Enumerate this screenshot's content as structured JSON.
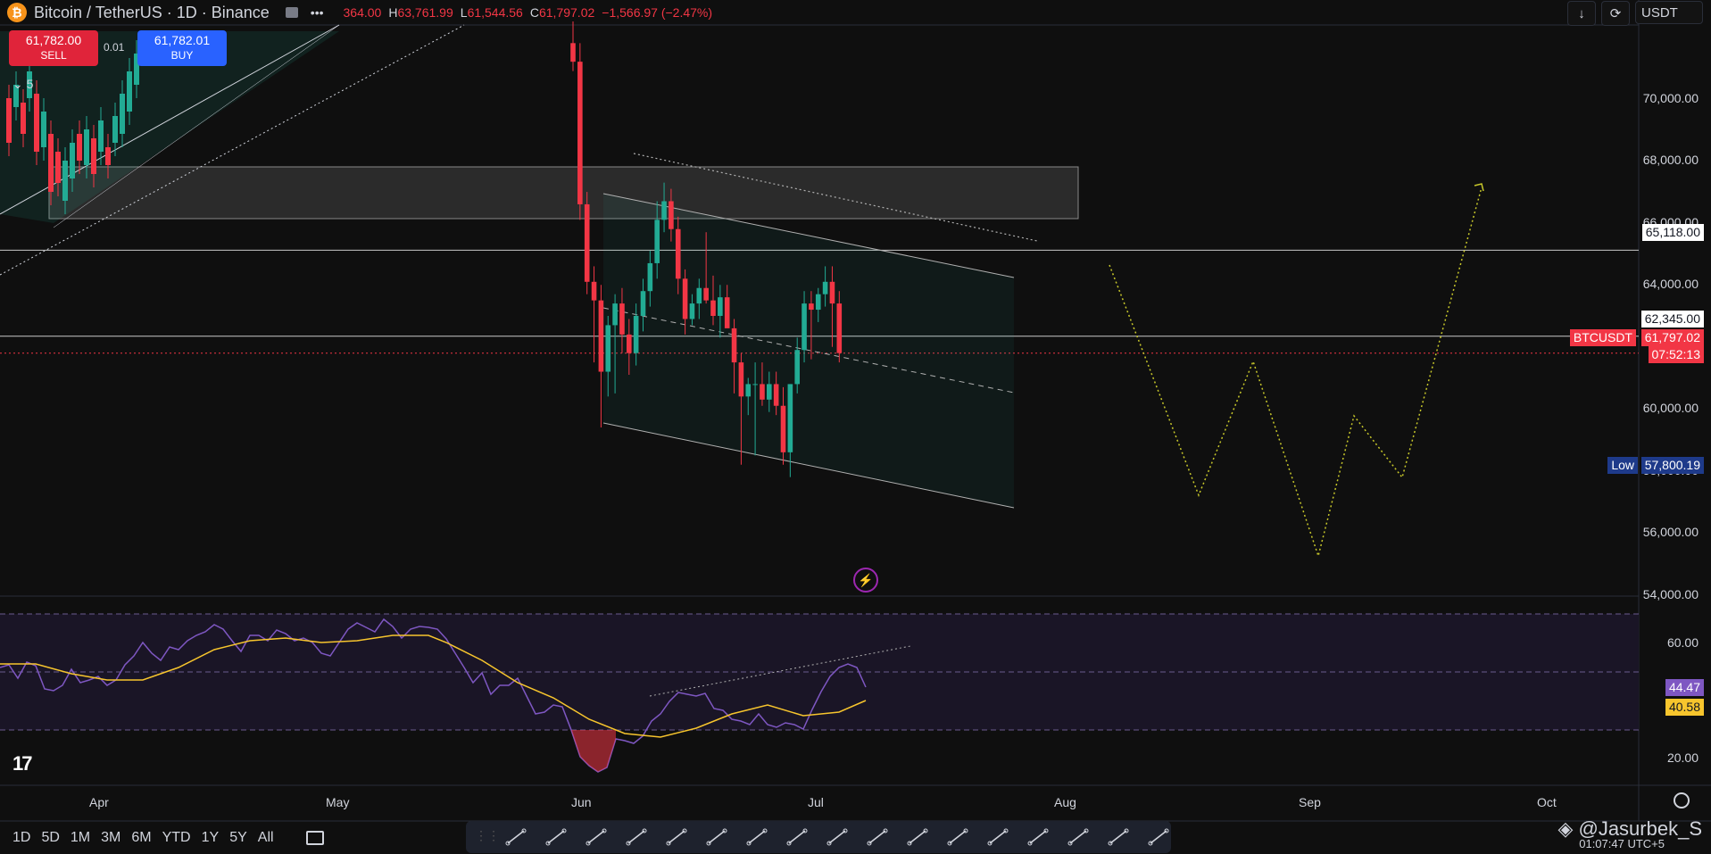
{
  "header": {
    "coin_icon": "bitcoin-icon",
    "symbol": "Bitcoin / TetherUS · 1D · Binance",
    "ohlc_open": "364.00",
    "ohlc_high_label": "H",
    "ohlc_high": "63,761.99",
    "ohlc_low_label": "L",
    "ohlc_low": "61,544.56",
    "ohlc_close_label": "C",
    "ohlc_close": "61,797.02",
    "ohlc_change": "−1,566.97 (−2.47%)",
    "currency": "USDT"
  },
  "trade": {
    "sell_price": "61,782.00",
    "sell_label": "SELL",
    "spread": "0.01",
    "buy_price": "61,782.01",
    "buy_label": "BUY",
    "collapse_count": "5"
  },
  "price_axis": {
    "ticks": [
      "70,000.00",
      "68,000.00",
      "66,000.00",
      "64,000.00",
      "60,000.00",
      "58,000.00",
      "56,000.00",
      "54,000.00"
    ],
    "tick_values": [
      70000,
      68000,
      66000,
      64000,
      60000,
      58000,
      56000,
      54000
    ],
    "line_65118": "65,118.00",
    "line_62345": "62,345.00",
    "ticker_tag": "BTCUSDT",
    "current_price": "61,797.02",
    "countdown": "07:52:13",
    "low_label": "Low",
    "low_value": "57,800.19"
  },
  "rsi_axis": {
    "ticks": [
      "60.00",
      "20.00"
    ],
    "rsi_value": "44.47",
    "ma_value": "40.58"
  },
  "time_axis": [
    "Apr",
    "May",
    "Jun",
    "Jul",
    "Aug",
    "Sep",
    "Oct"
  ],
  "ranges": [
    "1D",
    "5D",
    "1M",
    "3M",
    "6M",
    "YTD",
    "1Y",
    "5Y",
    "All"
  ],
  "footer": {
    "watermark": "@Jasurbek_S",
    "time": "01:07:47 UTC+5"
  },
  "colors": {
    "up": "#22ab94",
    "down": "#f23645",
    "rsi": "#7e57c2",
    "rsi_ma": "#f7c52d",
    "projection": "#c8c82a"
  },
  "chart_data": {
    "type": "candlestick",
    "ylim": [
      53500,
      72500
    ],
    "candles_may_jul": [
      {
        "o": 71800,
        "h": 72500,
        "l": 70900,
        "c": 71200
      },
      {
        "o": 71200,
        "h": 71800,
        "l": 66100,
        "c": 66600
      },
      {
        "o": 66600,
        "h": 67000,
        "l": 63700,
        "c": 64100
      },
      {
        "o": 64100,
        "h": 64600,
        "l": 61500,
        "c": 63500
      },
      {
        "o": 63500,
        "h": 64000,
        "l": 59400,
        "c": 61200
      },
      {
        "o": 61200,
        "h": 63000,
        "l": 60400,
        "c": 62700
      },
      {
        "o": 62700,
        "h": 63700,
        "l": 60500,
        "c": 63400
      },
      {
        "o": 63400,
        "h": 63900,
        "l": 61800,
        "c": 62400
      },
      {
        "o": 62400,
        "h": 62900,
        "l": 61100,
        "c": 61800
      },
      {
        "o": 61800,
        "h": 63400,
        "l": 61400,
        "c": 63000
      },
      {
        "o": 63000,
        "h": 64200,
        "l": 62500,
        "c": 63800
      },
      {
        "o": 63800,
        "h": 65100,
        "l": 63300,
        "c": 64700
      },
      {
        "o": 64700,
        "h": 66700,
        "l": 64200,
        "c": 66100
      },
      {
        "o": 66100,
        "h": 67300,
        "l": 65700,
        "c": 66700
      },
      {
        "o": 66700,
        "h": 67100,
        "l": 65400,
        "c": 65800
      },
      {
        "o": 65800,
        "h": 66200,
        "l": 63700,
        "c": 64200
      },
      {
        "o": 64200,
        "h": 64500,
        "l": 62400,
        "c": 62900
      },
      {
        "o": 62900,
        "h": 63700,
        "l": 62700,
        "c": 63400
      },
      {
        "o": 63400,
        "h": 64200,
        "l": 62900,
        "c": 63900
      },
      {
        "o": 63900,
        "h": 65700,
        "l": 63400,
        "c": 63500
      },
      {
        "o": 63500,
        "h": 64300,
        "l": 62700,
        "c": 63000
      },
      {
        "o": 63000,
        "h": 64000,
        "l": 62300,
        "c": 63600
      },
      {
        "o": 63600,
        "h": 64000,
        "l": 62900,
        "c": 62600
      },
      {
        "o": 62600,
        "h": 62900,
        "l": 60500,
        "c": 61500
      },
      {
        "o": 61500,
        "h": 61800,
        "l": 58200,
        "c": 60400
      },
      {
        "o": 60400,
        "h": 61000,
        "l": 59800,
        "c": 60800
      },
      {
        "o": 60800,
        "h": 61500,
        "l": 58500,
        "c": 60800
      },
      {
        "o": 60800,
        "h": 61500,
        "l": 60100,
        "c": 60300
      },
      {
        "o": 60300,
        "h": 61200,
        "l": 59900,
        "c": 60800
      },
      {
        "o": 60800,
        "h": 61200,
        "l": 59800,
        "c": 60100
      },
      {
        "o": 60100,
        "h": 60700,
        "l": 58200,
        "c": 58600
      },
      {
        "o": 58600,
        "h": 60800,
        "l": 57800,
        "c": 60800
      },
      {
        "o": 60800,
        "h": 62300,
        "l": 60500,
        "c": 61900
      },
      {
        "o": 61900,
        "h": 63800,
        "l": 61500,
        "c": 63400
      },
      {
        "o": 63400,
        "h": 63800,
        "l": 61600,
        "c": 63200
      },
      {
        "o": 63200,
        "h": 63900,
        "l": 62800,
        "c": 63700
      },
      {
        "o": 63700,
        "h": 64600,
        "l": 63300,
        "c": 64100
      },
      {
        "o": 64100,
        "h": 64600,
        "l": 62000,
        "c": 63400
      },
      {
        "o": 63400,
        "h": 63800,
        "l": 61500,
        "c": 61800
      }
    ]
  }
}
